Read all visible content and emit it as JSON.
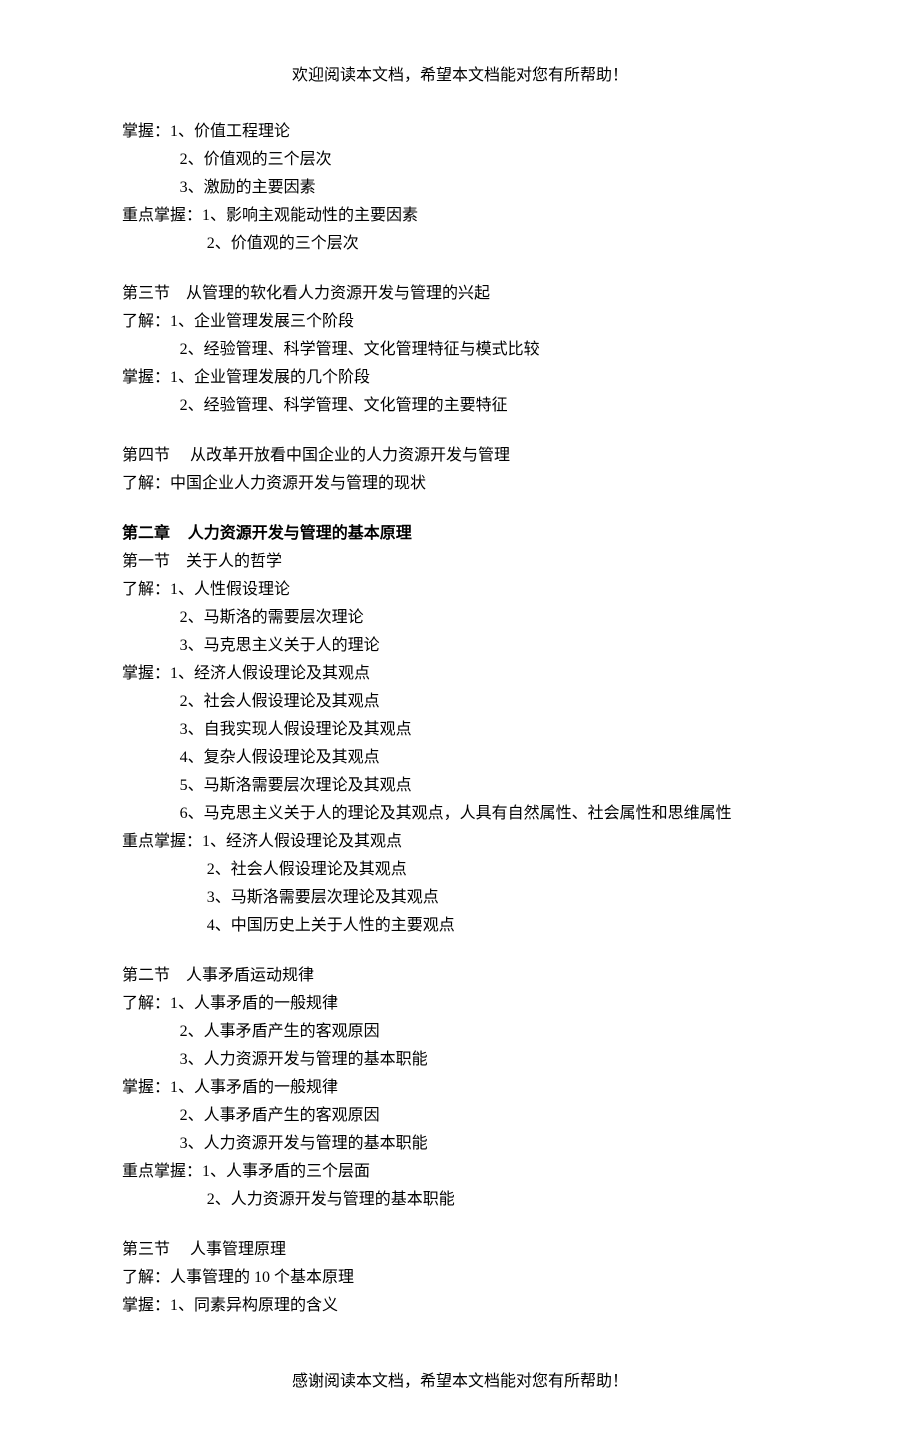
{
  "header": "欢迎阅读本文档，希望本文档能对您有所帮助！",
  "footer": "感谢阅读本文档，希望本文档能对您有所帮助！",
  "s1": {
    "grasp_label": "掌握：",
    "grasp_items": [
      "1、价值工程理论",
      "2、价值观的三个层次",
      "3、激励的主要因素"
    ],
    "key_label": "重点掌握：",
    "key_items": [
      "1、影响主观能动性的主要因素",
      "2、价值观的三个层次"
    ]
  },
  "s3": {
    "title": "第三节    从管理的软化看人力资源开发与管理的兴起",
    "under_label": "了解：",
    "under_items": [
      "1、企业管理发展三个阶段",
      "2、经验管理、科学管理、文化管理特征与模式比较"
    ],
    "grasp_label": "掌握：",
    "grasp_items": [
      "1、企业管理发展的几个阶段",
      "2、经验管理、科学管理、文化管理的主要特征"
    ]
  },
  "s4": {
    "title": "第四节     从改革开放看中国企业的人力资源开发与管理",
    "under": "了解：中国企业人力资源开发与管理的现状"
  },
  "ch2": {
    "title": "第二章    人力资源开发与管理的基本原理",
    "sec1": {
      "title": "第一节    关于人的哲学",
      "under_label": "了解：",
      "under_items": [
        "1、人性假设理论",
        "2、马斯洛的需要层次理论",
        "3、马克思主义关于人的理论"
      ],
      "grasp_label": "掌握：",
      "grasp_items": [
        "1、经济人假设理论及其观点",
        "2、社会人假设理论及其观点",
        "3、自我实现人假设理论及其观点",
        "4、复杂人假设理论及其观点",
        "5、马斯洛需要层次理论及其观点",
        "6、马克思主义关于人的理论及其观点，人具有自然属性、社会属性和思维属性"
      ],
      "key_label": "重点掌握：",
      "key_items": [
        "1、经济人假设理论及其观点",
        "2、社会人假设理论及其观点",
        "3、马斯洛需要层次理论及其观点",
        "4、中国历史上关于人性的主要观点"
      ]
    },
    "sec2": {
      "title": "第二节    人事矛盾运动规律",
      "under_label": "了解：",
      "under_items": [
        "1、人事矛盾的一般规律",
        "2、人事矛盾产生的客观原因",
        "3、人力资源开发与管理的基本职能"
      ],
      "grasp_label": "掌握：",
      "grasp_items": [
        "1、人事矛盾的一般规律",
        "2、人事矛盾产生的客观原因",
        "3、人力资源开发与管理的基本职能"
      ],
      "key_label": "重点掌握：",
      "key_items": [
        "1、人事矛盾的三个层面",
        "2、人力资源开发与管理的基本职能"
      ]
    },
    "sec3": {
      "title": "第三节     人事管理原理",
      "under": "了解：人事管理的 10 个基本原理",
      "grasp_label": "掌握：",
      "grasp_items": [
        "1、同素异构原理的含义"
      ]
    }
  }
}
